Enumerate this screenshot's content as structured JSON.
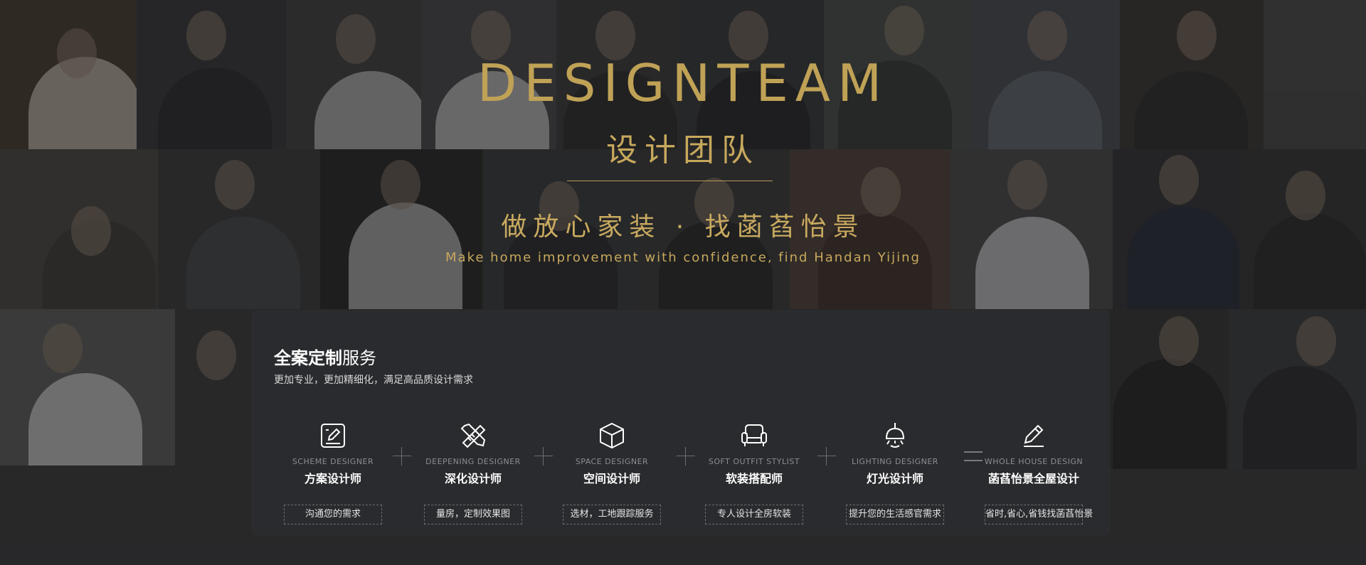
{
  "hero": {
    "title_en": "DESIGNTEAM",
    "title_cn": "设计团队",
    "slogan_cn": "做放心家装 · 找菡萏怡景",
    "slogan_en": "Make home improvement with confidence, find Handan Yijing"
  },
  "panel": {
    "title_bold": "全案定制",
    "title_light": "服务",
    "subtitle": "更加专业，更加精细化，满足高品质设计需求",
    "services": [
      {
        "icon": "edit-square-icon",
        "en": "SCHEME DESIGNER",
        "cn": "方案设计师",
        "tag": "沟通您的需求"
      },
      {
        "icon": "ruler-pencil-icon",
        "en": "DEEPENING DESIGNER",
        "cn": "深化设计师",
        "tag": "量房，定制效果图"
      },
      {
        "icon": "cube-icon",
        "en": "SPACE DESIGNER",
        "cn": "空间设计师",
        "tag": "选材，工地跟踪服务"
      },
      {
        "icon": "sofa-icon",
        "en": "SOFT OUTFIT STYLIST",
        "cn": "软装搭配师",
        "tag": "专人设计全房软装"
      },
      {
        "icon": "pendant-lamp-icon",
        "en": "LIGHTING DESIGNER",
        "cn": "灯光设计师",
        "tag": "提升您的生活感官需求"
      },
      {
        "icon": "pencil-icon",
        "en": "WHOLE HOUSE DESIGN",
        "cn": "菡萏怡景全屋设计",
        "tag": "省时,省心,省钱找菡萏怡景"
      }
    ]
  },
  "colors": {
    "gold": "#c0a256",
    "panel_bg": "#2a2b2e",
    "page_bg": "#2e2f31"
  }
}
